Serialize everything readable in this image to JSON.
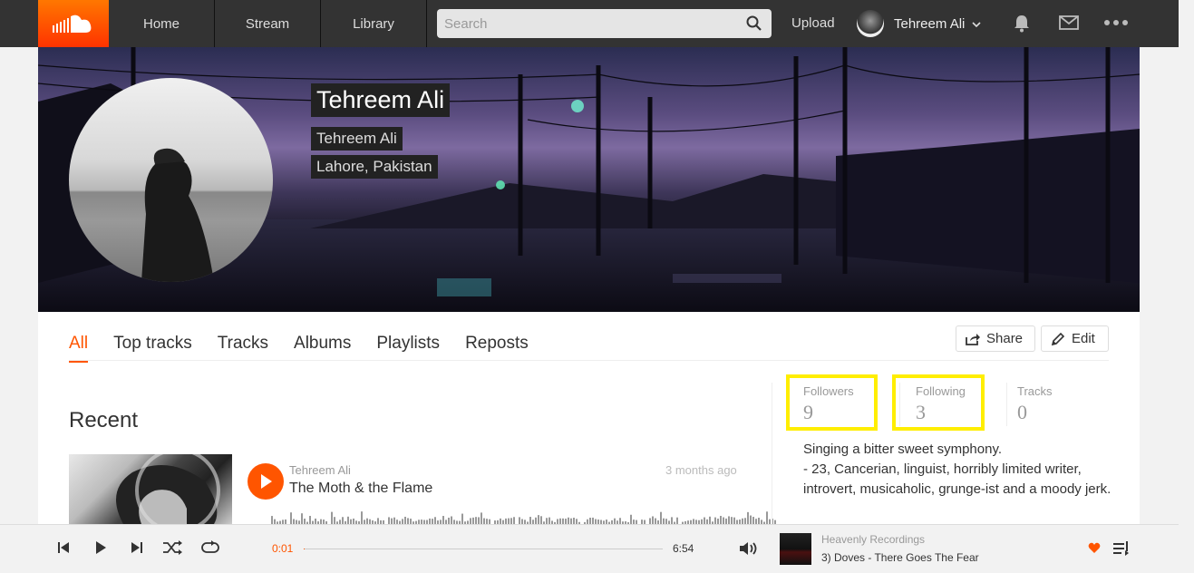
{
  "header": {
    "nav": [
      "Home",
      "Stream",
      "Library"
    ],
    "search_placeholder": "Search",
    "upload": "Upload",
    "user_name": "Tehreem Ali"
  },
  "banner": {
    "name": "Tehreem Ali",
    "subtitle": "Tehreem Ali",
    "location": "Lahore, Pakistan"
  },
  "tabs": [
    "All",
    "Top tracks",
    "Tracks",
    "Albums",
    "Playlists",
    "Reposts"
  ],
  "actions": {
    "share": "Share",
    "edit": "Edit"
  },
  "recent": {
    "heading": "Recent",
    "track": {
      "user": "Tehreem Ali",
      "title": "The Moth & the Flame",
      "posted": "3 months ago"
    }
  },
  "stats": {
    "followers_label": "Followers",
    "followers": "9",
    "following_label": "Following",
    "following": "3",
    "tracks_label": "Tracks",
    "tracks": "0"
  },
  "bio": "Singing a bitter sweet symphony.\n- 23, Cancerian, linguist, horribly limited writer, introvert, musicaholic, grunge-ist and a moody jerk.",
  "player": {
    "current_time": "0:01",
    "total_time": "6:54",
    "progress": 0.003,
    "now_playing_artist": "Heavenly Recordings",
    "now_playing_title": "3) Doves - There Goes The Fear"
  },
  "colors": {
    "accent": "#ff5500",
    "highlight": "#ffee00"
  }
}
